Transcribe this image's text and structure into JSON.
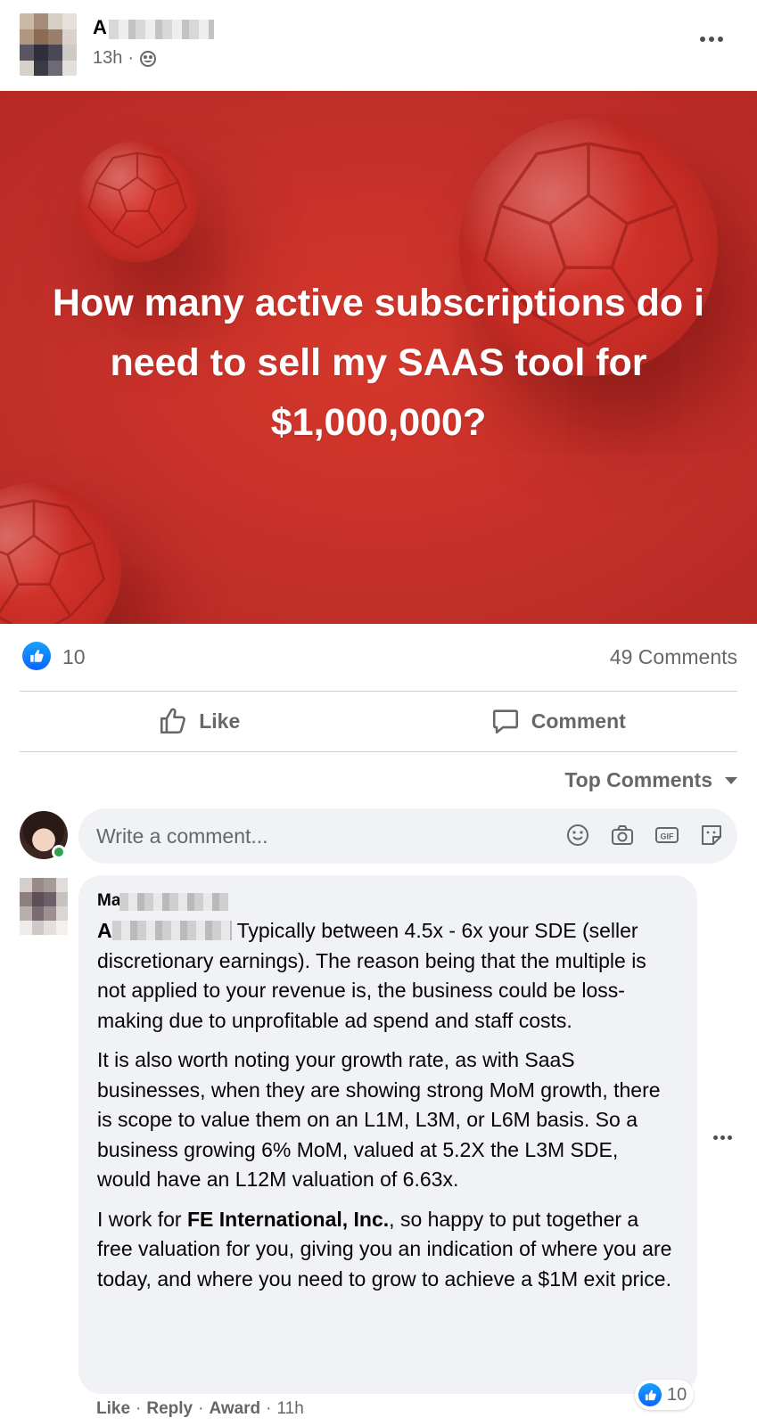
{
  "post": {
    "author_initial": "A",
    "time": "13h",
    "separator": "·",
    "image_text": "How many active subscriptions do i need to sell my SAAS tool for $1,000,000?",
    "like_count": "10",
    "comment_count": "49 Comments"
  },
  "actions": {
    "like_label": "Like",
    "comment_label": "Comment"
  },
  "comments_section": {
    "sort_label": "Top Comments",
    "composer_placeholder": "Write a comment..."
  },
  "comment": {
    "author_initial": "Ma",
    "tag_initial": "A",
    "text_1": "Typically between 4.5x - 6x your SDE (seller discretionary earnings). The reason being that the multiple is not applied to your revenue is, the business could be loss-making due to unprofitable ad spend and staff costs.",
    "text_2": "It is also worth noting your growth rate, as with SaaS businesses, when they are showing strong MoM growth, there is scope to value them on an L1M, L3M, or L6M basis. So a business growing 6% MoM, valued at 5.2X the L3M SDE, would have an L12M valuation of 6.63x.",
    "text_3_pre": "I work for ",
    "text_3_bold": "FE International, Inc.",
    "text_3_post": ", so happy to put together a free valuation for you, giving you an indication of where you are today, and where you need to grow to achieve a $1M exit price.",
    "reaction_count": "10",
    "like_action": "Like",
    "reply_action": "Reply",
    "award_action": "Award",
    "time": "11h",
    "dot": "·"
  },
  "colors": {
    "banner_red": "#c5302a",
    "like_blue": "#0866ff",
    "secondary_text": "#65676b",
    "bubble_bg": "#f0f2f5",
    "online_green": "#31a24c"
  },
  "icons": [
    "globe-icon",
    "more-options-icon",
    "like-reaction-icon",
    "like-thumb-icon",
    "comment-bubble-icon",
    "caret-down-icon",
    "emoji-icon",
    "camera-icon",
    "gif-icon",
    "sticker-icon"
  ]
}
